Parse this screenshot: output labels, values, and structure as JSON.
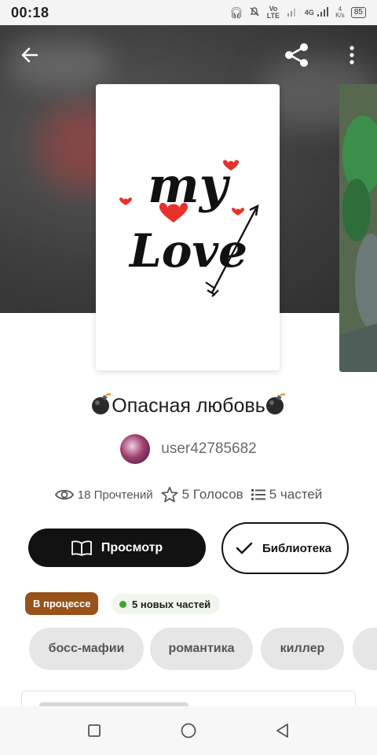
{
  "status_bar": {
    "time": "00:18",
    "network_labels": [
      "Vo LTE",
      "4G"
    ],
    "speed": "4 K/s",
    "battery": "85"
  },
  "header": {
    "icons": [
      "back-arrow-icon",
      "share-icon",
      "more-vertical-icon"
    ]
  },
  "story": {
    "title": "Опасная любовь",
    "title_emoji": "bomb-icon",
    "cover_text_line1": "my",
    "cover_text_line2": "Love",
    "author": "user42785682",
    "stats": {
      "reads": "18 Прочтений",
      "votes": "5 Голосов",
      "parts": "5 частей"
    }
  },
  "actions": {
    "read_label": "Просмотр",
    "library_label": "Библиотека"
  },
  "badges": {
    "status": "В процессе",
    "new_parts": "5 новых частей",
    "status_color": "#97531a",
    "new_dot_color": "#3aa33a"
  },
  "tags": [
    "босс-мафии",
    "романтика",
    "киллер"
  ],
  "nav_bar": {
    "icons": [
      "recent-apps-icon",
      "home-icon",
      "back-icon"
    ]
  }
}
